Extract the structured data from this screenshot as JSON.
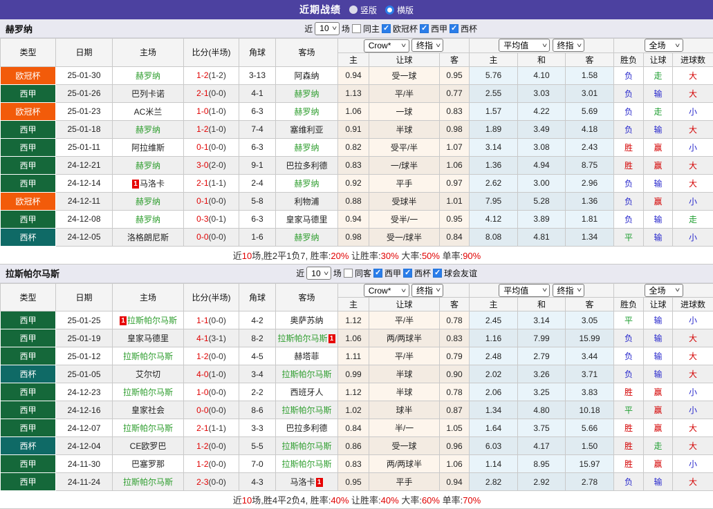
{
  "title_bar": {
    "title": "近期战绩",
    "radio_vertical": "竖版",
    "radio_horizontal": "横版"
  },
  "league_colors": {
    "欧冠杯": "#f25b0a",
    "西甲": "#15683a",
    "西杯": "#0f6a66"
  },
  "result_colors": {
    "胜": "#d40000",
    "平": "#1e9e30",
    "负": "#2727cc",
    "赢": "#d40000",
    "走": "#1e9e30",
    "输": "#2727cc",
    "大": "#d40000",
    "小": "#2727cc"
  },
  "table_header": {
    "type": "类型",
    "date": "日期",
    "home": "主场",
    "score": "比分(半场)",
    "corner": "角球",
    "away": "客场",
    "odds_select": "Crow*",
    "odds_select2": "终指",
    "avg_select": "平均值",
    "avg_select2": "终指",
    "scope_select": "全场",
    "odds_home": "主",
    "odds_line": "让球",
    "odds_away": "客",
    "avg_home": "主",
    "avg_draw": "和",
    "avg_away": "客",
    "res_outcome": "胜负",
    "res_handicap": "让球",
    "res_goals": "进球数"
  },
  "sections": [
    {
      "team": "赫罗纳",
      "filters": {
        "recent_label": "近",
        "recent_value": "10",
        "matches_label": "场",
        "same_label": "同主",
        "same_checked": false,
        "leagues": [
          "欧冠杯",
          "西甲",
          "西杯"
        ]
      },
      "rows": [
        {
          "league": "欧冠杯",
          "date": "25-01-30",
          "home": "赫罗纳",
          "home_subject": true,
          "home_card": "",
          "score": "1-2",
          "half": "(1-2)",
          "corners": "3-13",
          "away": "阿森纳",
          "away_subject": false,
          "away_card": "",
          "odds": [
            "0.94",
            "受一球",
            "0.95"
          ],
          "avg": [
            "5.76",
            "4.10",
            "1.58"
          ],
          "results": [
            "负",
            "走",
            "大"
          ]
        },
        {
          "league": "西甲",
          "date": "25-01-26",
          "home": "巴列卡诺",
          "home_subject": false,
          "home_card": "",
          "score": "2-1",
          "half": "(0-0)",
          "corners": "4-1",
          "away": "赫罗纳",
          "away_subject": true,
          "away_card": "",
          "odds": [
            "1.13",
            "平/半",
            "0.77"
          ],
          "avg": [
            "2.55",
            "3.03",
            "3.01"
          ],
          "results": [
            "负",
            "输",
            "大"
          ]
        },
        {
          "league": "欧冠杯",
          "date": "25-01-23",
          "home": "AC米兰",
          "home_subject": false,
          "home_card": "",
          "score": "1-0",
          "half": "(1-0)",
          "corners": "6-3",
          "away": "赫罗纳",
          "away_subject": true,
          "away_card": "",
          "odds": [
            "1.06",
            "一球",
            "0.83"
          ],
          "avg": [
            "1.57",
            "4.22",
            "5.69"
          ],
          "results": [
            "负",
            "走",
            "小"
          ]
        },
        {
          "league": "西甲",
          "date": "25-01-18",
          "home": "赫罗纳",
          "home_subject": true,
          "home_card": "",
          "score": "1-2",
          "half": "(1-0)",
          "corners": "7-4",
          "away": "塞维利亚",
          "away_subject": false,
          "away_card": "",
          "odds": [
            "0.91",
            "半球",
            "0.98"
          ],
          "avg": [
            "1.89",
            "3.49",
            "4.18"
          ],
          "results": [
            "负",
            "输",
            "大"
          ]
        },
        {
          "league": "西甲",
          "date": "25-01-11",
          "home": "阿拉维斯",
          "home_subject": false,
          "home_card": "",
          "score": "0-1",
          "half": "(0-0)",
          "corners": "6-3",
          "away": "赫罗纳",
          "away_subject": true,
          "away_card": "",
          "odds": [
            "0.82",
            "受平/半",
            "1.07"
          ],
          "avg": [
            "3.14",
            "3.08",
            "2.43"
          ],
          "results": [
            "胜",
            "赢",
            "小"
          ]
        },
        {
          "league": "西甲",
          "date": "24-12-21",
          "home": "赫罗纳",
          "home_subject": true,
          "home_card": "",
          "score": "3-0",
          "half": "(2-0)",
          "corners": "9-1",
          "away": "巴拉多利德",
          "away_subject": false,
          "away_card": "",
          "odds": [
            "0.83",
            "一/球半",
            "1.06"
          ],
          "avg": [
            "1.36",
            "4.94",
            "8.75"
          ],
          "results": [
            "胜",
            "赢",
            "大"
          ]
        },
        {
          "league": "西甲",
          "date": "24-12-14",
          "home": "马洛卡",
          "home_subject": false,
          "home_card": "1",
          "score": "2-1",
          "half": "(1-1)",
          "corners": "2-4",
          "away": "赫罗纳",
          "away_subject": true,
          "away_card": "",
          "odds": [
            "0.92",
            "平手",
            "0.97"
          ],
          "avg": [
            "2.62",
            "3.00",
            "2.96"
          ],
          "results": [
            "负",
            "输",
            "大"
          ]
        },
        {
          "league": "欧冠杯",
          "date": "24-12-11",
          "home": "赫罗纳",
          "home_subject": true,
          "home_card": "",
          "score": "0-1",
          "half": "(0-0)",
          "corners": "5-8",
          "away": "利物浦",
          "away_subject": false,
          "away_card": "",
          "odds": [
            "0.88",
            "受球半",
            "1.01"
          ],
          "avg": [
            "7.95",
            "5.28",
            "1.36"
          ],
          "results": [
            "负",
            "赢",
            "小"
          ]
        },
        {
          "league": "西甲",
          "date": "24-12-08",
          "home": "赫罗纳",
          "home_subject": true,
          "home_card": "",
          "score": "0-3",
          "half": "(0-1)",
          "corners": "6-3",
          "away": "皇家马德里",
          "away_subject": false,
          "away_card": "",
          "odds": [
            "0.94",
            "受半/一",
            "0.95"
          ],
          "avg": [
            "4.12",
            "3.89",
            "1.81"
          ],
          "results": [
            "负",
            "输",
            "走"
          ]
        },
        {
          "league": "西杯",
          "date": "24-12-05",
          "home": "洛格朗尼斯",
          "home_subject": false,
          "home_card": "",
          "score": "0-0",
          "half": "(0-0)",
          "corners": "1-6",
          "away": "赫罗纳",
          "away_subject": true,
          "away_card": "",
          "odds": [
            "0.98",
            "受一/球半",
            "0.84"
          ],
          "avg": [
            "8.08",
            "4.81",
            "1.34"
          ],
          "results": [
            "平",
            "输",
            "小"
          ]
        }
      ],
      "footer": [
        {
          "text": "近"
        },
        {
          "text": "10",
          "red": true
        },
        {
          "text": "场,胜2平1负7, 胜率:"
        },
        {
          "text": "20%",
          "red": true
        },
        {
          "text": " 让胜率:"
        },
        {
          "text": "30%",
          "red": true
        },
        {
          "text": " 大率:"
        },
        {
          "text": "50%",
          "red": true
        },
        {
          "text": " 单率:"
        },
        {
          "text": "90%",
          "red": true
        }
      ]
    },
    {
      "team": "拉斯帕尔马斯",
      "filters": {
        "recent_label": "近",
        "recent_value": "10",
        "matches_label": "场",
        "same_label": "同客",
        "same_checked": false,
        "leagues": [
          "西甲",
          "西杯",
          "球会友谊"
        ]
      },
      "rows": [
        {
          "league": "西甲",
          "date": "25-01-25",
          "home": "拉斯帕尔马斯",
          "home_subject": true,
          "home_card": "1",
          "score": "1-1",
          "half": "(0-0)",
          "corners": "4-2",
          "away": "奥萨苏纳",
          "away_subject": false,
          "away_card": "",
          "odds": [
            "1.12",
            "平/半",
            "0.78"
          ],
          "avg": [
            "2.45",
            "3.14",
            "3.05"
          ],
          "results": [
            "平",
            "输",
            "小"
          ]
        },
        {
          "league": "西甲",
          "date": "25-01-19",
          "home": "皇家马德里",
          "home_subject": false,
          "home_card": "",
          "score": "4-1",
          "half": "(3-1)",
          "corners": "8-2",
          "away": "拉斯帕尔马斯",
          "away_subject": true,
          "away_card": "1",
          "odds": [
            "1.06",
            "两/两球半",
            "0.83"
          ],
          "avg": [
            "1.16",
            "7.99",
            "15.99"
          ],
          "results": [
            "负",
            "输",
            "大"
          ]
        },
        {
          "league": "西甲",
          "date": "25-01-12",
          "home": "拉斯帕尔马斯",
          "home_subject": true,
          "home_card": "",
          "score": "1-2",
          "half": "(0-0)",
          "corners": "4-5",
          "away": "赫塔菲",
          "away_subject": false,
          "away_card": "",
          "odds": [
            "1.11",
            "平/半",
            "0.79"
          ],
          "avg": [
            "2.48",
            "2.79",
            "3.44"
          ],
          "results": [
            "负",
            "输",
            "大"
          ]
        },
        {
          "league": "西杯",
          "date": "25-01-05",
          "home": "艾尔切",
          "home_subject": false,
          "home_card": "",
          "score": "4-0",
          "half": "(1-0)",
          "corners": "3-4",
          "away": "拉斯帕尔马斯",
          "away_subject": true,
          "away_card": "",
          "odds": [
            "0.99",
            "半球",
            "0.90"
          ],
          "avg": [
            "2.02",
            "3.26",
            "3.71"
          ],
          "results": [
            "负",
            "输",
            "大"
          ]
        },
        {
          "league": "西甲",
          "date": "24-12-23",
          "home": "拉斯帕尔马斯",
          "home_subject": true,
          "home_card": "",
          "score": "1-0",
          "half": "(0-0)",
          "corners": "2-2",
          "away": "西班牙人",
          "away_subject": false,
          "away_card": "",
          "odds": [
            "1.12",
            "半球",
            "0.78"
          ],
          "avg": [
            "2.06",
            "3.25",
            "3.83"
          ],
          "results": [
            "胜",
            "赢",
            "小"
          ]
        },
        {
          "league": "西甲",
          "date": "24-12-16",
          "home": "皇家社会",
          "home_subject": false,
          "home_card": "",
          "score": "0-0",
          "half": "(0-0)",
          "corners": "8-6",
          "away": "拉斯帕尔马斯",
          "away_subject": true,
          "away_card": "",
          "odds": [
            "1.02",
            "球半",
            "0.87"
          ],
          "avg": [
            "1.34",
            "4.80",
            "10.18"
          ],
          "results": [
            "平",
            "赢",
            "小"
          ]
        },
        {
          "league": "西甲",
          "date": "24-12-07",
          "home": "拉斯帕尔马斯",
          "home_subject": true,
          "home_card": "",
          "score": "2-1",
          "half": "(1-1)",
          "corners": "3-3",
          "away": "巴拉多利德",
          "away_subject": false,
          "away_card": "",
          "odds": [
            "0.84",
            "半/一",
            "1.05"
          ],
          "avg": [
            "1.64",
            "3.75",
            "5.66"
          ],
          "results": [
            "胜",
            "赢",
            "大"
          ]
        },
        {
          "league": "西杯",
          "date": "24-12-04",
          "home": "CE欧罗巴",
          "home_subject": false,
          "home_card": "",
          "score": "1-2",
          "half": "(0-0)",
          "corners": "5-5",
          "away": "拉斯帕尔马斯",
          "away_subject": true,
          "away_card": "",
          "odds": [
            "0.86",
            "受一球",
            "0.96"
          ],
          "avg": [
            "6.03",
            "4.17",
            "1.50"
          ],
          "results": [
            "胜",
            "走",
            "大"
          ]
        },
        {
          "league": "西甲",
          "date": "24-11-30",
          "home": "巴塞罗那",
          "home_subject": false,
          "home_card": "",
          "score": "1-2",
          "half": "(0-0)",
          "corners": "7-0",
          "away": "拉斯帕尔马斯",
          "away_subject": true,
          "away_card": "",
          "odds": [
            "0.83",
            "两/两球半",
            "1.06"
          ],
          "avg": [
            "1.14",
            "8.95",
            "15.97"
          ],
          "results": [
            "胜",
            "赢",
            "小"
          ]
        },
        {
          "league": "西甲",
          "date": "24-11-24",
          "home": "拉斯帕尔马斯",
          "home_subject": true,
          "home_card": "",
          "score": "2-3",
          "half": "(0-0)",
          "corners": "4-3",
          "away": "马洛卡",
          "away_subject": false,
          "away_card": "1",
          "odds": [
            "0.95",
            "平手",
            "0.94"
          ],
          "avg": [
            "2.82",
            "2.92",
            "2.78"
          ],
          "results": [
            "负",
            "输",
            "大"
          ]
        }
      ],
      "footer": [
        {
          "text": "近"
        },
        {
          "text": "10",
          "red": true
        },
        {
          "text": "场,胜4平2负4, 胜率:"
        },
        {
          "text": "40%",
          "red": true
        },
        {
          "text": " 让胜率:"
        },
        {
          "text": "40%",
          "red": true
        },
        {
          "text": " 大率:"
        },
        {
          "text": "60%",
          "red": true
        },
        {
          "text": " 单率:"
        },
        {
          "text": "70%",
          "red": true
        }
      ]
    }
  ]
}
